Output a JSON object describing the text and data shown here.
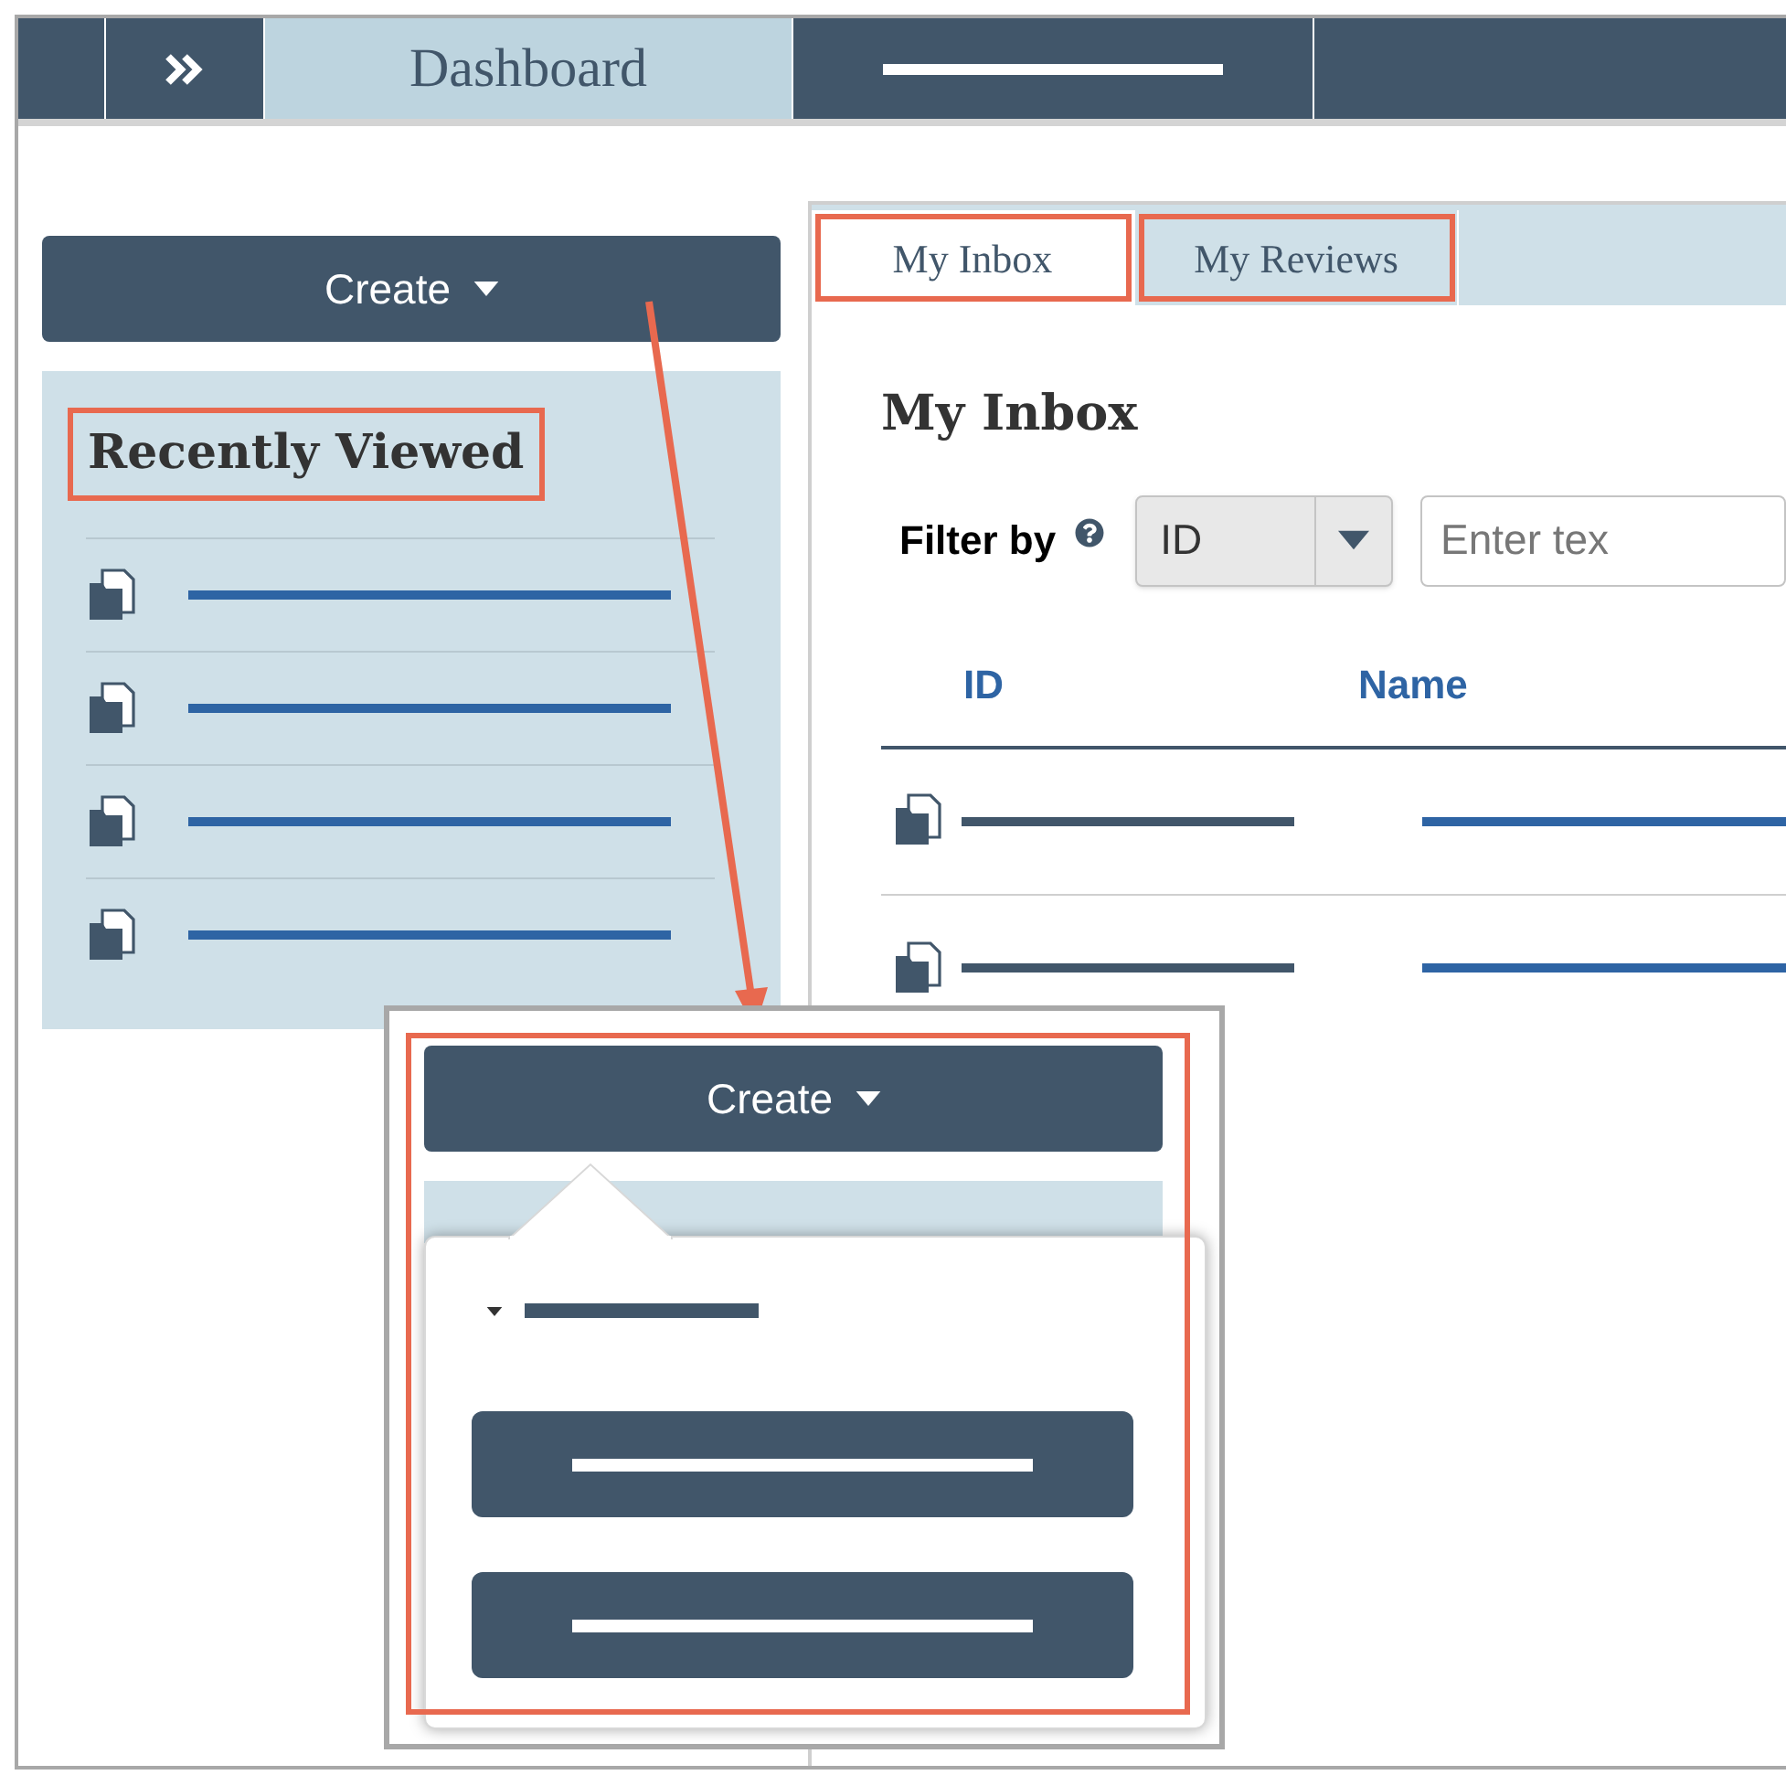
{
  "nav": {
    "title": "Dashboard",
    "redacted_tab": true
  },
  "create_button": {
    "label": "Create"
  },
  "recently_viewed": {
    "title": "Recently Viewed",
    "highlighted": true,
    "items": [
      {
        "redacted": true
      },
      {
        "redacted": true
      },
      {
        "redacted": true
      },
      {
        "redacted": true
      }
    ]
  },
  "tabs": [
    {
      "label": "My Inbox",
      "selected": true,
      "highlighted": true
    },
    {
      "label": "My Reviews",
      "selected": false,
      "highlighted": true
    }
  ],
  "inbox": {
    "title": "My Inbox",
    "filter_label": "Filter by",
    "filter_value": "ID",
    "search": {
      "placeholder": "Enter tex"
    },
    "columns": [
      "ID",
      "Name"
    ],
    "rows": [
      {
        "redacted": true
      },
      {
        "redacted": true
      }
    ]
  },
  "callout": {
    "create_button": {
      "label": "Create"
    },
    "highlighted": true,
    "menu": [
      {
        "kind": "section"
      },
      {
        "kind": "button"
      },
      {
        "kind": "button"
      }
    ]
  }
}
